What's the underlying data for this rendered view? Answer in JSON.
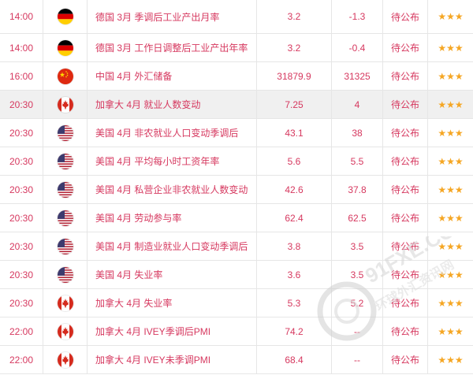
{
  "rows": [
    {
      "time": "14:00",
      "flag": "germany-flag",
      "name": "德国 3月 季调后工业产出月率",
      "value": "3.2",
      "previous": "-1.3",
      "status": "待公布",
      "stars": "★★★",
      "highlight": false
    },
    {
      "time": "14:00",
      "flag": "germany-flag",
      "name": "德国 3月 工作日调整后工业产出年率",
      "value": "3.2",
      "previous": "-0.4",
      "status": "待公布",
      "stars": "★★★",
      "highlight": false
    },
    {
      "time": "16:00",
      "flag": "china-flag",
      "name": "中国 4月 外汇储备",
      "value": "31879.9",
      "previous": "31325",
      "status": "待公布",
      "stars": "★★★",
      "highlight": false
    },
    {
      "time": "20:30",
      "flag": "canada-flag",
      "name": "加拿大 4月 就业人数变动",
      "value": "7.25",
      "previous": "4",
      "status": "待公布",
      "stars": "★★★",
      "highlight": true
    },
    {
      "time": "20:30",
      "flag": "usa-flag",
      "name": "美国 4月 非农就业人口变动季调后",
      "value": "43.1",
      "previous": "38",
      "status": "待公布",
      "stars": "★★★",
      "highlight": false
    },
    {
      "time": "20:30",
      "flag": "usa-flag",
      "name": "美国 4月 平均每小时工资年率",
      "value": "5.6",
      "previous": "5.5",
      "status": "待公布",
      "stars": "★★★",
      "highlight": false
    },
    {
      "time": "20:30",
      "flag": "usa-flag",
      "name": "美国 4月 私营企业非农就业人数变动",
      "value": "42.6",
      "previous": "37.8",
      "status": "待公布",
      "stars": "★★★",
      "highlight": false
    },
    {
      "time": "20:30",
      "flag": "usa-flag",
      "name": "美国 4月 劳动参与率",
      "value": "62.4",
      "previous": "62.5",
      "status": "待公布",
      "stars": "★★★",
      "highlight": false
    },
    {
      "time": "20:30",
      "flag": "usa-flag",
      "name": "美国 4月 制造业就业人口变动季调后",
      "value": "3.8",
      "previous": "3.5",
      "status": "待公布",
      "stars": "★★★",
      "highlight": false
    },
    {
      "time": "20:30",
      "flag": "usa-flag",
      "name": "美国 4月 失业率",
      "value": "3.6",
      "previous": "3.5",
      "status": "待公布",
      "stars": "★★★",
      "highlight": false
    },
    {
      "time": "20:30",
      "flag": "canada-flag",
      "name": "加拿大 4月 失业率",
      "value": "5.3",
      "previous": "5.2",
      "status": "待公布",
      "stars": "★★★",
      "highlight": false
    },
    {
      "time": "22:00",
      "flag": "canada-flag",
      "name": "加拿大 4月 IVEY季调后PMI",
      "value": "74.2",
      "previous": "--",
      "status": "待公布",
      "stars": "★★★",
      "highlight": false
    },
    {
      "time": "22:00",
      "flag": "canada-flag",
      "name": "加拿大 4月 IVEY未季调PMI",
      "value": "68.4",
      "previous": "--",
      "status": "待公布",
      "stars": "★★★",
      "highlight": false
    }
  ],
  "watermark": {
    "text": "91FXE.COM",
    "subtext": "环球外汇资讯网"
  }
}
